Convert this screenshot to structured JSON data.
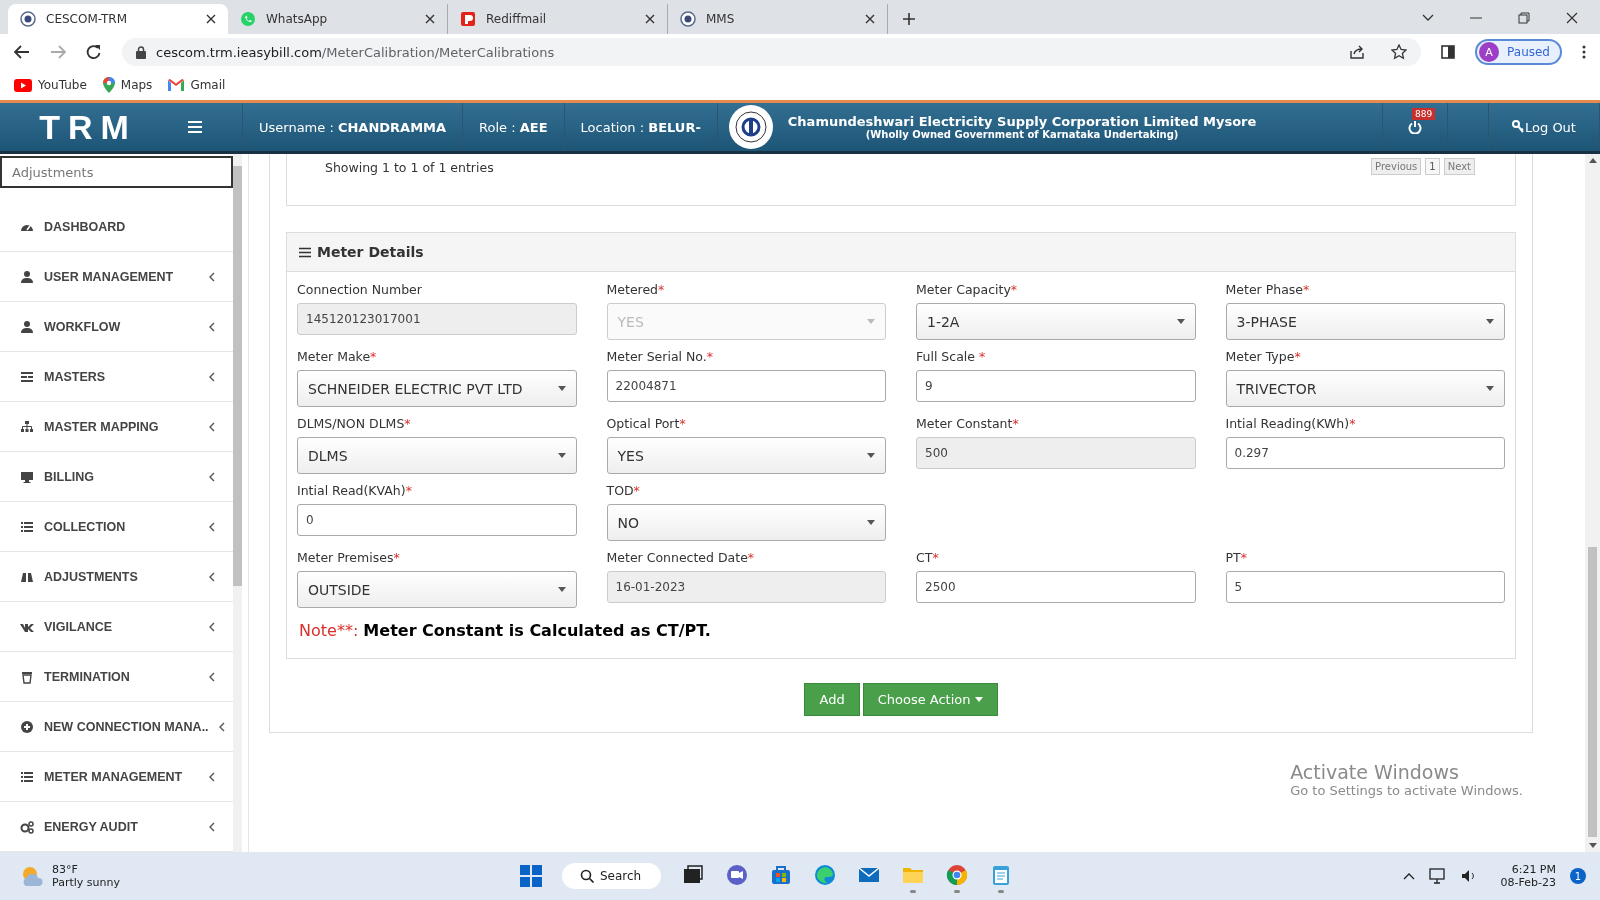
{
  "browser": {
    "tabs": [
      {
        "title": "CESCOM-TRM",
        "selected": true
      },
      {
        "title": "WhatsApp",
        "selected": false
      },
      {
        "title": "Rediffmail",
        "selected": false
      },
      {
        "title": "MMS",
        "selected": false
      }
    ],
    "url_host": "cescom.trm.ieasybill.com",
    "url_path": "/MeterCalibration/MeterCalibrations",
    "profile": {
      "initial": "A",
      "status": "Paused"
    },
    "bookmarks": [
      {
        "label": "YouTube"
      },
      {
        "label": "Maps"
      },
      {
        "label": "Gmail"
      }
    ]
  },
  "header": {
    "logo": "TRM",
    "user_label": "Username : ",
    "user": "CHANDRAMMA",
    "role_label": "Role : ",
    "role": "AEE",
    "location_label": "Location : ",
    "location": "BELUR-",
    "org": "Chamundeshwari Electricity Supply Corporation Limited Mysore",
    "org_sub": "(Wholly Owned Government of Karnataka Undertaking)",
    "notifications": "889",
    "logout": "Log Out"
  },
  "sidebar": {
    "search": "Adjustments",
    "items": [
      {
        "label": "DASHBOARD",
        "submenu": false
      },
      {
        "label": "USER MANAGEMENT",
        "submenu": true
      },
      {
        "label": "WORKFLOW",
        "submenu": true
      },
      {
        "label": "MASTERS",
        "submenu": true
      },
      {
        "label": "MASTER MAPPING",
        "submenu": true
      },
      {
        "label": "BILLING",
        "submenu": true
      },
      {
        "label": "COLLECTION",
        "submenu": true
      },
      {
        "label": "ADJUSTMENTS",
        "submenu": true
      },
      {
        "label": "VIGILANCE",
        "submenu": true
      },
      {
        "label": "TERMINATION",
        "submenu": true
      },
      {
        "label": "NEW CONNECTION MANA..",
        "submenu": true
      },
      {
        "label": "METER MANAGEMENT",
        "submenu": true
      },
      {
        "label": "ENERGY AUDIT",
        "submenu": true
      }
    ]
  },
  "table_footer": {
    "info": "Showing 1 to 1 of 1 entries",
    "pager": [
      {
        "label": "Previous",
        "selected": false
      },
      {
        "label": "1",
        "selected": true
      },
      {
        "label": "Next",
        "selected": false
      }
    ]
  },
  "meter_details": {
    "title": "Meter Details",
    "rows": [
      [
        {
          "label": "Connection Number",
          "kind": "text",
          "value": "145120123017001",
          "readonly": true
        },
        {
          "label": "Metered",
          "required": "*",
          "kind": "select",
          "value": "YES",
          "readonly": true
        },
        {
          "label": "Meter Capacity",
          "required": "*",
          "kind": "select",
          "value": "1-2A",
          "readonly": false
        },
        {
          "label": "Meter Phase",
          "required": "*",
          "kind": "select",
          "value": "3-PHASE",
          "readonly": false
        }
      ],
      [
        {
          "label": "Meter Make",
          "required": "*",
          "kind": "select",
          "value": "SCHNEIDER ELECTRIC PVT LTD",
          "readonly": false
        },
        {
          "label": "Meter Serial No.",
          "required": "*",
          "kind": "text",
          "value": "22004871",
          "readonly": false
        },
        {
          "label": "Full Scale ",
          "required": "*",
          "kind": "text",
          "value": "9",
          "readonly": false
        },
        {
          "label": "Meter Type",
          "required": "*",
          "kind": "select",
          "value": "TRIVECTOR",
          "readonly": false
        }
      ],
      [
        {
          "label": "DLMS/NON DLMS",
          "required": "*",
          "kind": "select",
          "value": "DLMS",
          "readonly": false
        },
        {
          "label": "Optical Port",
          "required": "*",
          "kind": "select",
          "value": "YES",
          "readonly": false
        },
        {
          "label": "Meter Constant",
          "required": "*",
          "kind": "text",
          "value": "500",
          "readonly": true
        },
        {
          "label": "Intial Reading(KWh)",
          "required": "*",
          "kind": "text",
          "value": "0.297",
          "readonly": false
        }
      ],
      [
        {
          "label": "Intial Read(KVAh)",
          "required": "*",
          "kind": "text",
          "value": "0",
          "readonly": false
        },
        {
          "label": "TOD",
          "required": "*",
          "kind": "select",
          "value": "NO",
          "readonly": false
        }
      ],
      [
        {
          "label": "Meter Premises",
          "required": "*",
          "kind": "select",
          "value": "OUTSIDE",
          "readonly": false
        },
        {
          "label": "Meter Connected Date",
          "required": "*",
          "kind": "text",
          "value": "16-01-2023",
          "readonly": true
        },
        {
          "label": "CT",
          "required": "*",
          "kind": "text",
          "value": "2500",
          "readonly": false
        },
        {
          "label": "PT",
          "required": "*",
          "kind": "text",
          "value": "5",
          "readonly": false
        }
      ]
    ],
    "note_label": "Note**: ",
    "note": "Meter Constant is Calculated as CT/PT."
  },
  "actions": [
    {
      "label": "Add",
      "kind": "button"
    },
    {
      "label": "Choose Action",
      "kind": "dropdown"
    }
  ],
  "activation": {
    "title": "Activate Windows",
    "text": "Go to Settings to activate Windows."
  },
  "taskbar": {
    "weather": {
      "temp": "83°F",
      "text": "Partly sunny"
    },
    "search": "Search",
    "apps": [
      {
        "running": false
      },
      {
        "running": false
      },
      {
        "running": false
      },
      {
        "running": false
      },
      {
        "running": false
      },
      {
        "running": true
      },
      {
        "running": true
      },
      {
        "running": true
      }
    ],
    "time": "6:21 PM",
    "date": "08-Feb-23",
    "badge": "1"
  }
}
